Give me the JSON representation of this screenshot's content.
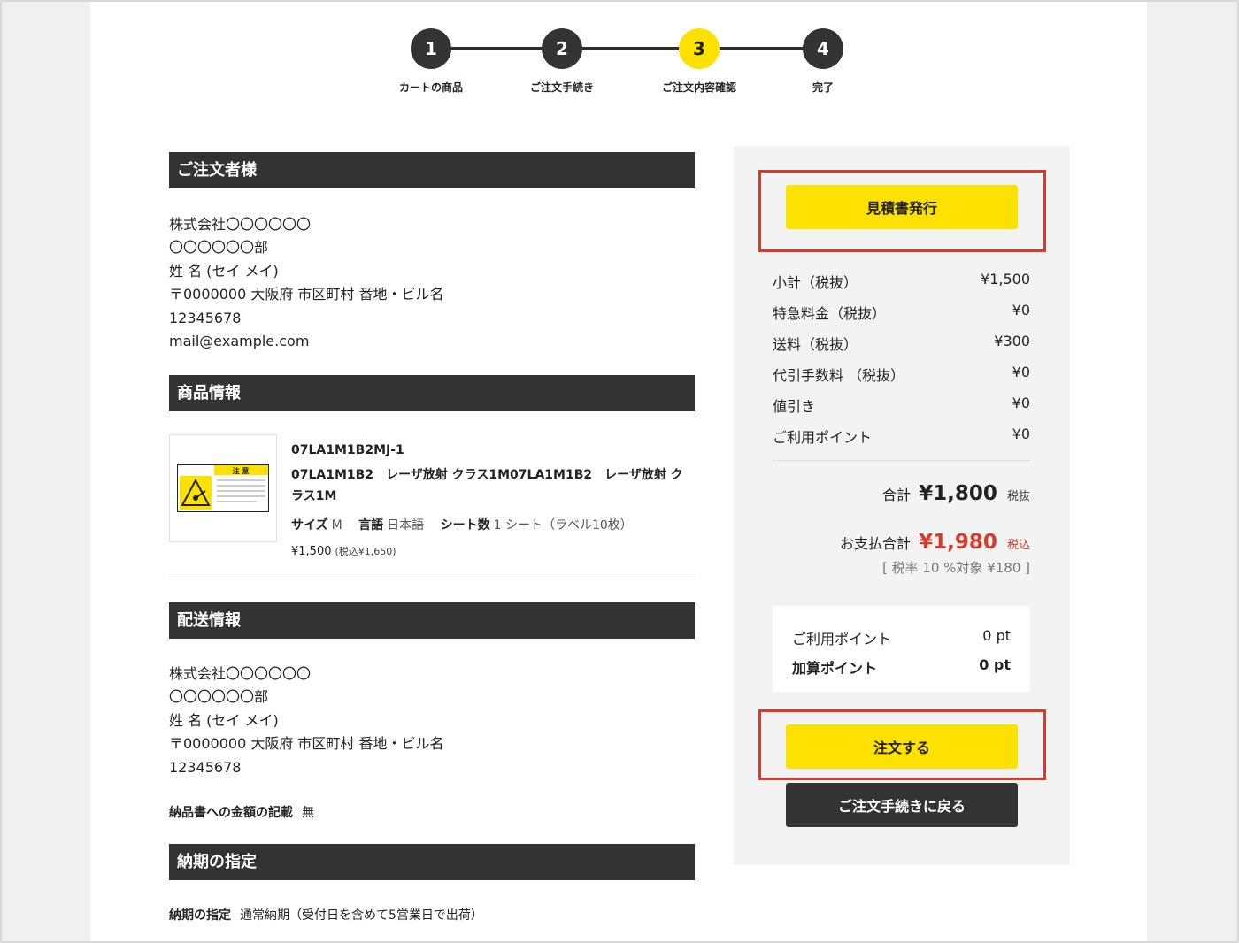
{
  "steps": [
    {
      "num": "1",
      "label": "カートの商品"
    },
    {
      "num": "2",
      "label": "ご注文手続き"
    },
    {
      "num": "3",
      "label": "ご注文内容確認"
    },
    {
      "num": "4",
      "label": "完了"
    }
  ],
  "orderer": {
    "heading": "ご注文者様",
    "lines": [
      "株式会社〇〇〇〇〇〇",
      "〇〇〇〇〇〇部",
      "姓 名 (セイ メイ)",
      "〒0000000 大阪府 市区町村 番地・ビル名",
      "12345678",
      "mail@example.com"
    ]
  },
  "product_section": {
    "heading": "商品情報",
    "image_label": "注 意",
    "code": "07LA1M1B2MJ-1",
    "name": "07LA1M1B2　レーザ放射 クラス1M07LA1M1B2　レーザ放射 クラス1M",
    "size_label": "サイズ",
    "size_value": "M",
    "lang_label": "言語",
    "lang_value": "日本語",
    "sheet_label": "シート数",
    "sheet_value": "1 シート（ラベル10枚）",
    "price": "¥1,500",
    "price_tax": "(税込¥1,650)"
  },
  "shipping": {
    "heading": "配送情報",
    "lines": [
      "株式会社〇〇〇〇〇〇",
      "〇〇〇〇〇〇部",
      "姓 名 (セイ メイ)",
      "〒0000000 大阪府 市区町村 番地・ビル名",
      "12345678"
    ],
    "invoice_label": "納品書への金額の記載",
    "invoice_value": "無"
  },
  "delivery": {
    "heading": "納期の指定",
    "label": "納期の指定",
    "value": "通常納期（受付日を含めて5営業日で出荷）"
  },
  "summary": {
    "quote_button": "見積書発行",
    "rows": [
      {
        "label": "小計（税抜）",
        "value": "¥1,500"
      },
      {
        "label": "特急料金（税抜）",
        "value": "¥0"
      },
      {
        "label": "送料（税抜）",
        "value": "¥300"
      },
      {
        "label": "代引手数料 （税抜）",
        "value": "¥0"
      },
      {
        "label": "値引き",
        "value": "¥0"
      },
      {
        "label": "ご利用ポイント",
        "value": "¥0"
      }
    ],
    "total_label": "合計",
    "total_value": "¥1,800",
    "total_suffix": "税抜",
    "pay_label": "お支払合計",
    "pay_value": "¥1,980",
    "pay_suffix": "税込",
    "tax_note": "[ 税率 10 %対象 ¥180 ]",
    "points": [
      {
        "label": "ご利用ポイント",
        "value": "0 pt"
      },
      {
        "label": "加算ポイント",
        "value": "0 pt"
      }
    ],
    "order_button": "注文する",
    "back_button": "ご注文手続きに戻る"
  },
  "colors": {
    "accent": "#ffe100",
    "dark": "#333333",
    "highlight": "#d93a2e",
    "price_red": "#d93a2e"
  }
}
